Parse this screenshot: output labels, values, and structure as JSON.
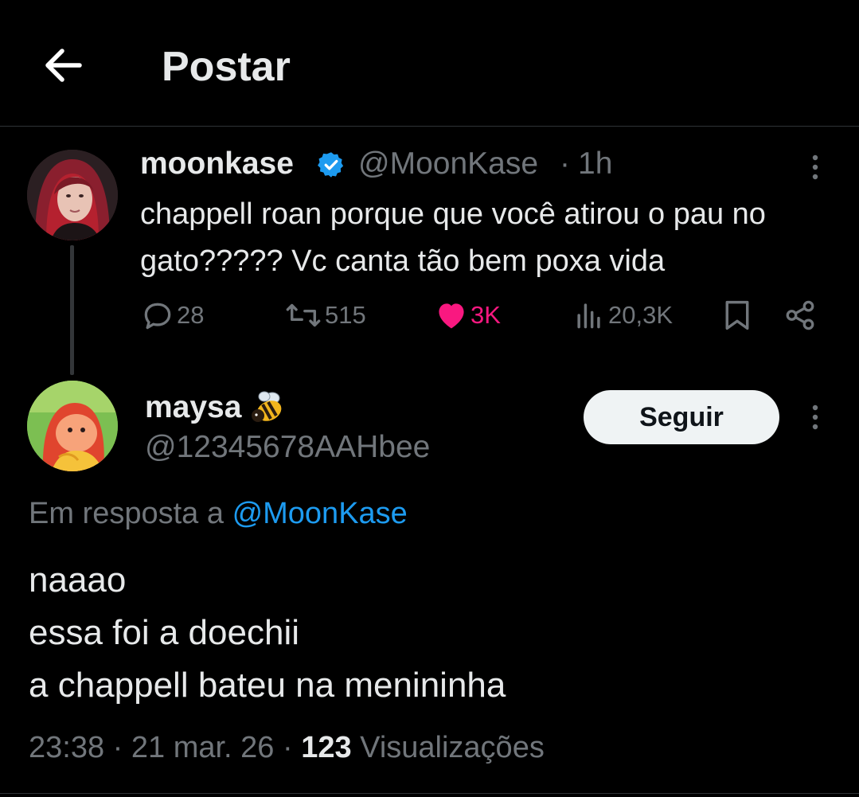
{
  "header": {
    "title": "Postar"
  },
  "original_post": {
    "display_name": "moonkase",
    "handle": "@MoonKase",
    "separator": "·",
    "time": "1h",
    "text": "chappell roan porque que você atirou o pau no gato????? Vc canta tão bem poxa vida",
    "actions": {
      "replies": "28",
      "reposts": "515",
      "likes": "3K",
      "views": "20,3K"
    },
    "colors": {
      "verified": "#1d9bf0",
      "liked": "#f91880"
    },
    "icons": [
      "reply-icon",
      "repost-icon",
      "heart-icon",
      "views-icon",
      "bookmark-icon",
      "share-icon"
    ]
  },
  "reply_post": {
    "display_name": "maysa",
    "display_emoji": "bee-emoji",
    "handle": "@12345678AAHbee",
    "follow_label": "Seguir",
    "reply_prefix": "Em resposta a",
    "reply_mention": "@MoonKase",
    "text_lines": [
      "naaao",
      "essa foi a doechii",
      "a chappell bateu na menininha"
    ],
    "timestamp": "23:38 · 21 mar. 26 ·",
    "views_count": "123",
    "views_label": "Visualizações"
  },
  "theme": {
    "background": "#000000",
    "text": "#e7e9ea",
    "muted": "#71767b",
    "accent": "#1d9bf0"
  }
}
